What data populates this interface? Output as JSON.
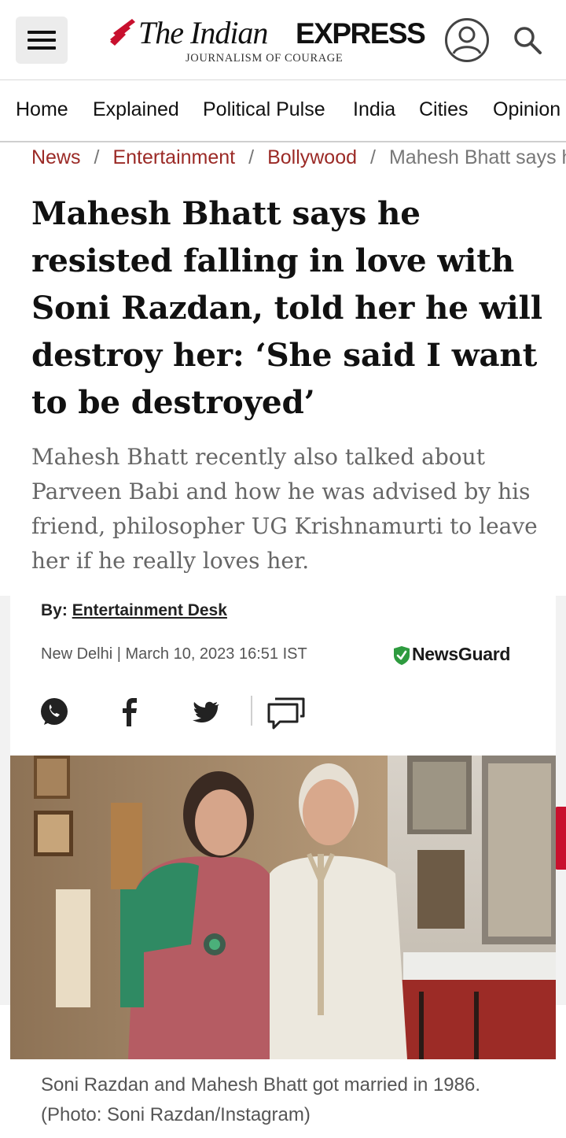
{
  "header": {
    "logo_the": "The Indian",
    "logo_express": "EXPRESS",
    "logo_tagline": "JOURNALISM OF COURAGE"
  },
  "nav": {
    "items": [
      "Home",
      "Explained",
      "Political Pulse",
      "India",
      "Cities",
      "Opinion"
    ]
  },
  "breadcrumb": {
    "links": [
      "News",
      "Entertainment",
      "Bollywood"
    ],
    "separator": "/",
    "current": "Mahesh Bhatt says he resisted falling in love with Soni Razdan"
  },
  "article": {
    "headline": "Mahesh Bhatt says he resisted falling in love with Soni Razdan, told her he will destroy her: ‘She said I want to be destroyed’",
    "deck": "Mahesh Bhatt recently also talked about Parveen Babi and how he was advised by his friend, philosopher UG Krishnamurti to leave her if he really loves her.",
    "byline_prefix": "By:",
    "author": "Entertainment Desk",
    "dateline": "New Delhi | March 10, 2023 16:51 IST",
    "newsguard": "NewsGuard",
    "photo_caption": "Soni Razdan and Mahesh Bhatt got married in 1986. (Photo: Soni Razdan/Instagram)"
  },
  "share": {
    "icons": [
      "whatsapp-icon",
      "facebook-icon",
      "twitter-icon",
      "comments-icon"
    ]
  },
  "colors": {
    "brand_red": "#c8102e",
    "breadcrumb_link": "#9b2a26",
    "newsguard_green": "#2e9b3f"
  }
}
